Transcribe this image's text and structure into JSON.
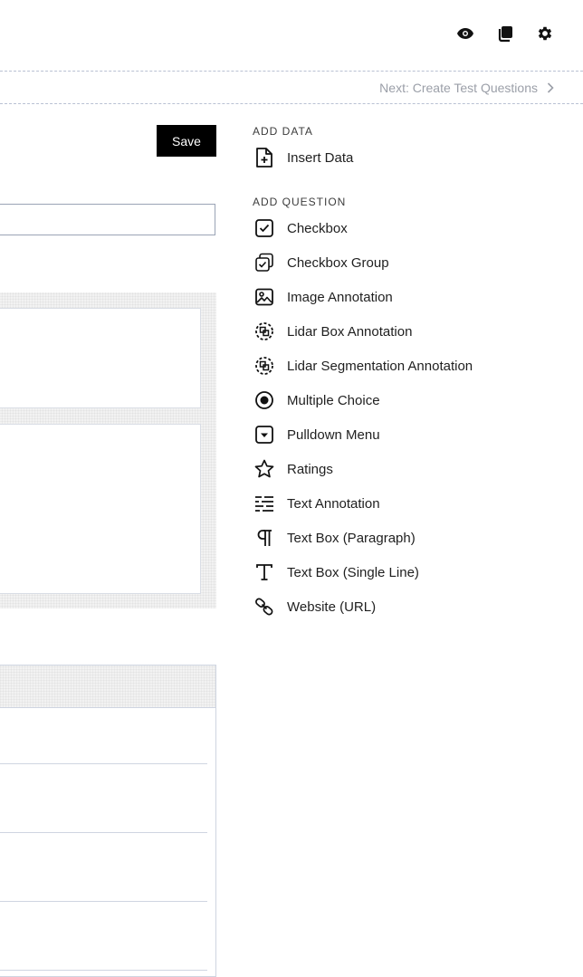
{
  "toolbar": {
    "icons": [
      "eye-icon",
      "copy-icon",
      "gear-icon"
    ]
  },
  "navigation": {
    "next_label": "Next: Create Test Questions"
  },
  "editor": {
    "save_label": "Save"
  },
  "sidebar": {
    "add_data_heading": "ADD DATA",
    "add_data_items": [
      {
        "label": "Insert Data",
        "icon": "file-plus-icon"
      }
    ],
    "add_question_heading": "ADD QUESTION",
    "add_question_items": [
      {
        "label": "Checkbox",
        "icon": "checkbox-icon"
      },
      {
        "label": "Checkbox Group",
        "icon": "checkbox-group-icon"
      },
      {
        "label": "Image Annotation",
        "icon": "image-icon"
      },
      {
        "label": "Lidar Box Annotation",
        "icon": "lidar-box-icon"
      },
      {
        "label": "Lidar Segmentation Annotation",
        "icon": "lidar-segmentation-icon"
      },
      {
        "label": "Multiple Choice",
        "icon": "radio-icon"
      },
      {
        "label": "Pulldown Menu",
        "icon": "pulldown-icon"
      },
      {
        "label": "Ratings",
        "icon": "star-icon"
      },
      {
        "label": "Text Annotation",
        "icon": "text-annotation-icon"
      },
      {
        "label": "Text Box (Paragraph)",
        "icon": "paragraph-icon"
      },
      {
        "label": "Text Box (Single Line)",
        "icon": "text-t-icon"
      },
      {
        "label": "Website (URL)",
        "icon": "link-icon"
      }
    ]
  },
  "colors": {
    "accent": "#000000",
    "muted_text": "#9b9fa8",
    "divider": "#b9c1d3"
  }
}
